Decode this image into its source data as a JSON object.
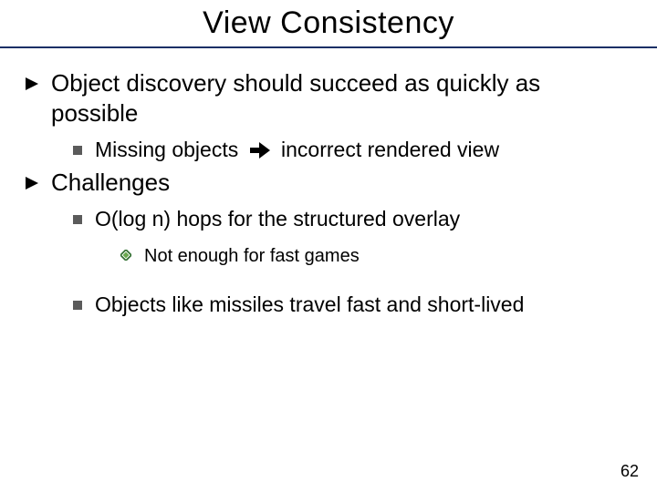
{
  "title": "View Consistency",
  "bullets": {
    "b1": "Object discovery should succeed as quickly as possible",
    "b1_1_pre": "Missing objects",
    "b1_1_arrow": "→",
    "b1_1_post": "incorrect rendered view",
    "b2": "Challenges",
    "b2_1": "O(log n) hops for the structured overlay",
    "b2_1_1": "Not enough for fast games",
    "b2_2": "Objects like missiles travel fast and short-lived"
  },
  "page_number": "62",
  "icons": {
    "arrow": "right-triangle-icon",
    "square": "square-bullet-icon",
    "diamond": "diamond-bullet-icon",
    "implies": "implies-arrow-icon"
  }
}
